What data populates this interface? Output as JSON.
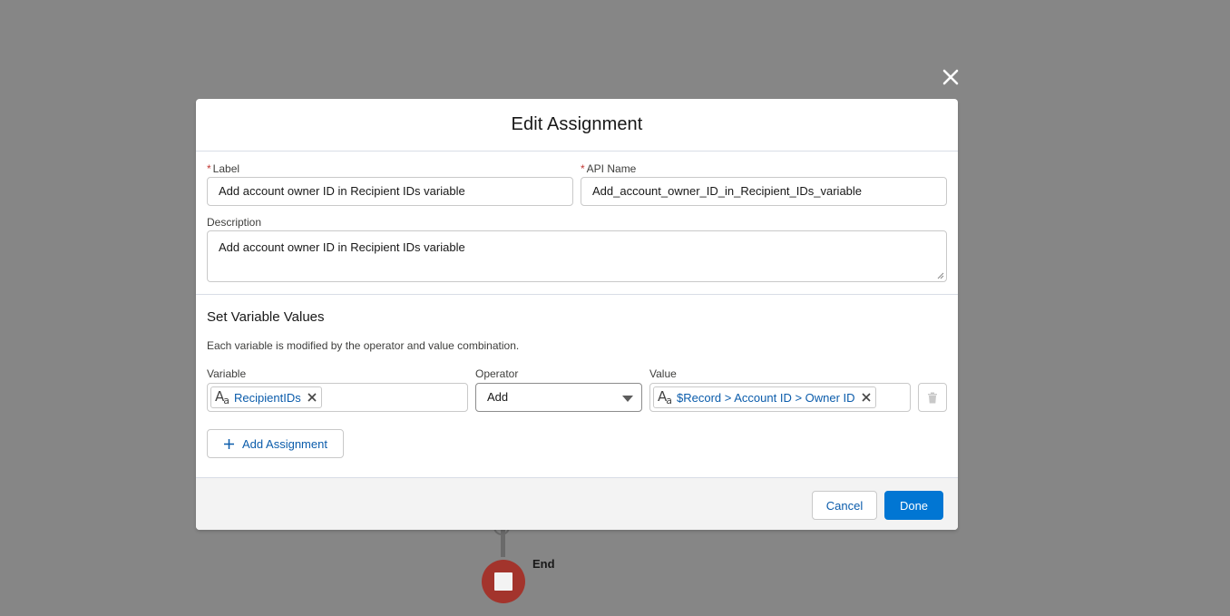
{
  "canvas": {
    "end_label": "End"
  },
  "modal": {
    "title": "Edit Assignment",
    "close_icon": "close-icon",
    "label_field": {
      "label": "Label",
      "required_marker": "*",
      "value": "Add account owner ID in Recipient IDs variable"
    },
    "api_name_field": {
      "label": "API Name",
      "required_marker": "*",
      "value": "Add_account_owner_ID_in_Recipient_IDs_variable"
    },
    "description_field": {
      "label": "Description",
      "value": "Add account owner ID in Recipient IDs variable"
    },
    "variables_section": {
      "title": "Set Variable Values",
      "subtitle": "Each variable is modified by the operator and value combination.",
      "column_variable": "Variable",
      "column_operator": "Operator",
      "column_value": "Value",
      "rows": [
        {
          "variable": "RecipientIDs",
          "variable_icon": "text-type-icon",
          "operator": "Add",
          "value": "$Record > Account ID > Owner ID",
          "value_icon": "text-type-icon"
        }
      ],
      "add_button_label": "Add Assignment"
    },
    "footer": {
      "cancel_label": "Cancel",
      "done_label": "Done"
    }
  },
  "colors": {
    "overlay": "#868686",
    "brand": "#0176d3",
    "link": "#0b5cab",
    "end_node": "#a3342c"
  }
}
